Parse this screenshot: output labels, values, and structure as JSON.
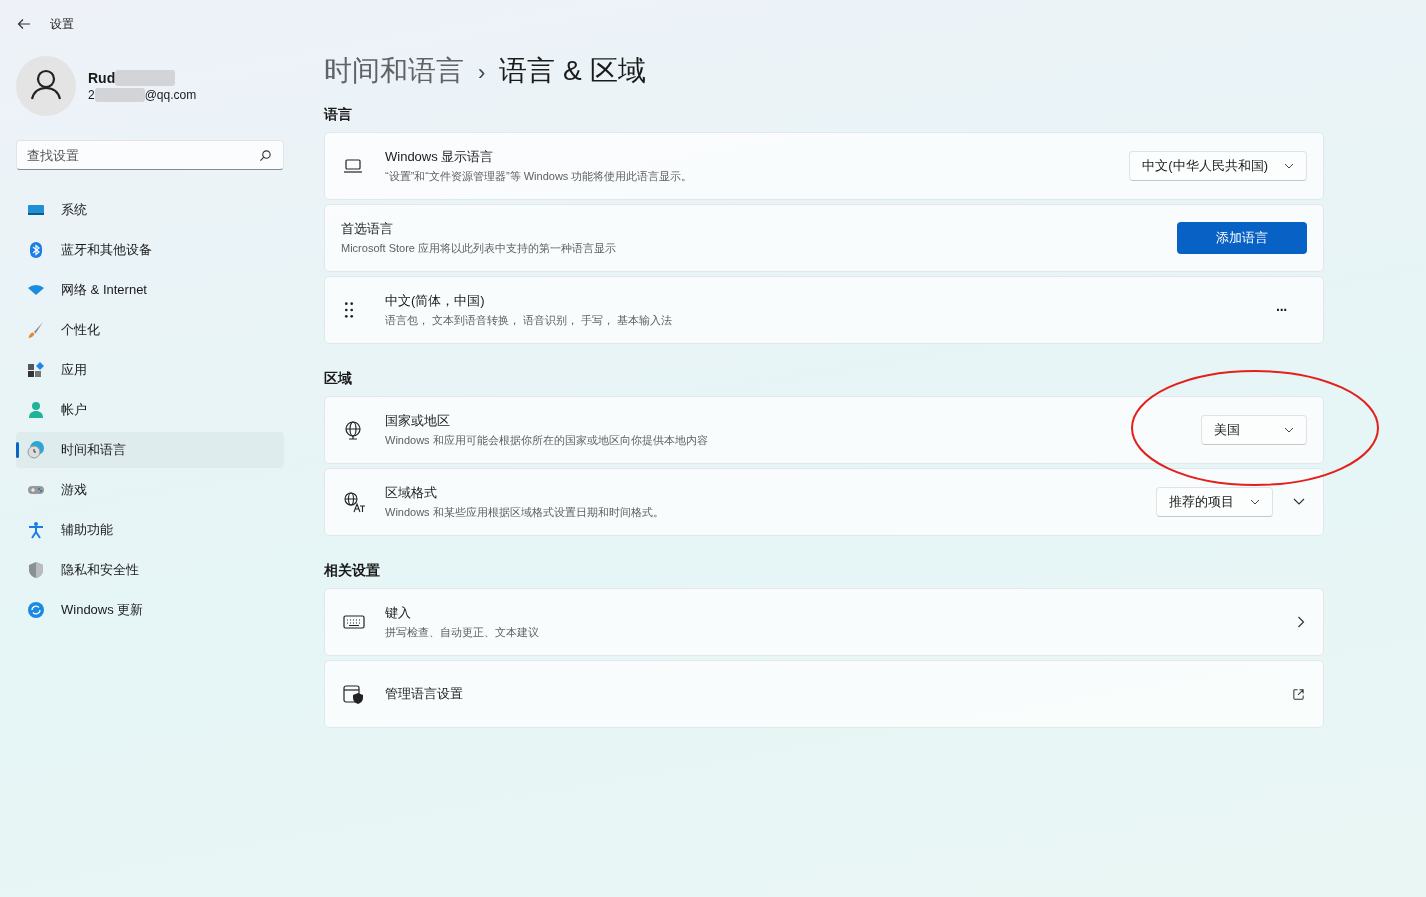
{
  "window": {
    "title": "设置"
  },
  "user": {
    "name": "Rud",
    "email_start": "2",
    "email_end": "@qq.com"
  },
  "search": {
    "placeholder": "查找设置"
  },
  "sidebar": {
    "items": [
      {
        "label": "系统",
        "selected": false
      },
      {
        "label": "蓝牙和其他设备",
        "selected": false
      },
      {
        "label": "网络 & Internet",
        "selected": false
      },
      {
        "label": "个性化",
        "selected": false
      },
      {
        "label": "应用",
        "selected": false
      },
      {
        "label": "帐户",
        "selected": false
      },
      {
        "label": "时间和语言",
        "selected": true
      },
      {
        "label": "游戏",
        "selected": false
      },
      {
        "label": "辅助功能",
        "selected": false
      },
      {
        "label": "隐私和安全性",
        "selected": false
      },
      {
        "label": "Windows 更新",
        "selected": false
      }
    ]
  },
  "breadcrumb": {
    "parent": "时间和语言",
    "separator": "›",
    "current": "语言 & 区域"
  },
  "sections": [
    {
      "heading": "语言",
      "cards": [
        {
          "kind": "dropdown",
          "title": "Windows 显示语言",
          "subtitle": "“设置”和“文件资源管理器”等 Windows 功能将使用此语言显示。",
          "value": "中文(中华人民共和国)",
          "annotated": false
        },
        {
          "kind": "button",
          "title": "首选语言",
          "subtitle": "Microsoft Store 应用将以此列表中支持的第一种语言显示",
          "button": "添加语言"
        },
        {
          "kind": "menu",
          "title": "中文(简体，中国)",
          "subtitle": "语言包，  文本到语音转换，  语音识别，  手写，  基本输入法",
          "menu": "···"
        }
      ]
    },
    {
      "heading": "区域",
      "cards": [
        {
          "kind": "dropdown",
          "title": "国家或地区",
          "subtitle": "Windows 和应用可能会根据你所在的国家或地区向你提供本地内容",
          "value": "美国",
          "annotated": true
        },
        {
          "kind": "dropdown-expand",
          "title": "区域格式",
          "subtitle": "Windows 和某些应用根据区域格式设置日期和时间格式。",
          "value": "推荐的项目",
          "annotated": false
        }
      ]
    },
    {
      "heading": "相关设置",
      "cards": [
        {
          "kind": "link",
          "title": "键入",
          "subtitle": "拼写检查、自动更正、文本建议"
        },
        {
          "kind": "external",
          "title": "管理语言设置"
        }
      ]
    }
  ]
}
